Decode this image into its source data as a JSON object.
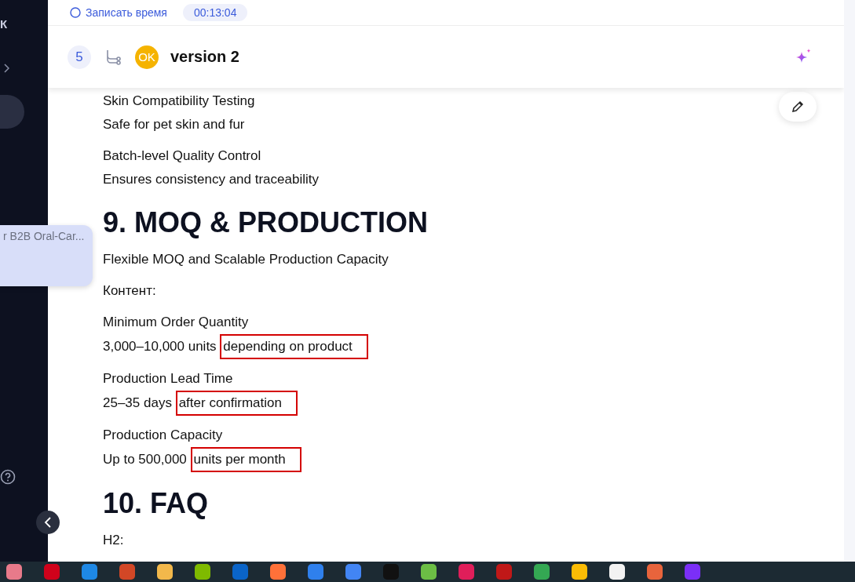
{
  "top_bar": {
    "record_time": "Записать время",
    "timer": "00:13:04"
  },
  "sidebar": {
    "title": "К",
    "tooltip": "r B2B Oral-Car..."
  },
  "header": {
    "count": "5",
    "avatar": "OK",
    "title": "version 2"
  },
  "content": [
    {
      "kind": "text",
      "text": "Skin Compatibility Testing"
    },
    {
      "kind": "text",
      "text": "Safe for pet skin and fur"
    },
    {
      "kind": "gap"
    },
    {
      "kind": "text",
      "text": "Batch-level Quality Control"
    },
    {
      "kind": "text",
      "text": "Ensures consistency and traceability"
    },
    {
      "kind": "heading",
      "text": "9. MOQ & PRODUCTION"
    },
    {
      "kind": "text",
      "text": "Flexible MOQ and Scalable Production Capacity"
    },
    {
      "kind": "gap"
    },
    {
      "kind": "text",
      "text": "Контент:"
    },
    {
      "kind": "gap"
    },
    {
      "kind": "text",
      "text": "Minimum Order Quantity"
    },
    {
      "kind": "marked",
      "text": "3,000–10,000 units",
      "boxed": "depending on product"
    },
    {
      "kind": "gap"
    },
    {
      "kind": "text",
      "text": "Production Lead Time"
    },
    {
      "kind": "marked",
      "text": "25–35 days",
      "boxed": "after confirmation"
    },
    {
      "kind": "gap"
    },
    {
      "kind": "text",
      "text": "Production Capacity"
    },
    {
      "kind": "marked",
      "text": "Up to 500,000",
      "boxed": "units per month"
    },
    {
      "kind": "heading",
      "text": "10. FAQ"
    },
    {
      "kind": "text",
      "text": "H2:"
    }
  ],
  "taskbar": [
    {
      "color": "#e87a8a"
    },
    {
      "color": "#d0021b"
    },
    {
      "color": "#1e88e5"
    },
    {
      "color": "#d24726"
    },
    {
      "color": "#f2b84b"
    },
    {
      "color": "#7fba00"
    },
    {
      "color": "#0a64c8"
    },
    {
      "color": "#ff7139"
    },
    {
      "color": "#2f80ed"
    },
    {
      "color": "#4285f4"
    },
    {
      "color": "#111111"
    },
    {
      "color": "#6cbe45"
    },
    {
      "color": "#e01e5a"
    },
    {
      "color": "#c01818"
    },
    {
      "color": "#34a853"
    },
    {
      "color": "#fbbc05"
    },
    {
      "color": "#f2f2f2"
    },
    {
      "color": "#e8643c"
    },
    {
      "color": "#7b2ff7"
    }
  ]
}
